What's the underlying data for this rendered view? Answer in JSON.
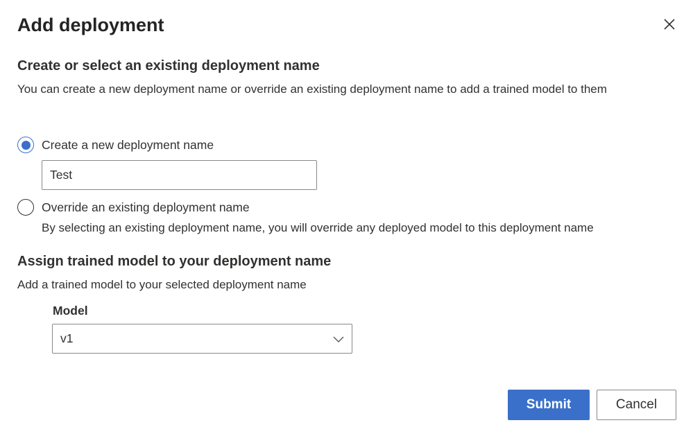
{
  "dialog": {
    "title": "Add deployment",
    "close_icon": "close-icon"
  },
  "section_name": {
    "heading": "Create or select an existing deployment name",
    "description": "You can create a new deployment name or override an existing deployment name to add a trained model to them",
    "option_create": {
      "label": "Create a new deployment name",
      "selected": true,
      "input_value": "Test"
    },
    "option_override": {
      "label": "Override an existing deployment name",
      "selected": false,
      "description": "By selecting an existing deployment name, you will override any deployed model to this deployment name"
    }
  },
  "section_model": {
    "heading": "Assign trained model to your deployment name",
    "description": "Add a trained model to your selected deployment name",
    "model_label": "Model",
    "model_value": "v1",
    "dropdown_icon": "chevron-down-icon"
  },
  "footer": {
    "submit_label": "Submit",
    "cancel_label": "Cancel"
  },
  "colors": {
    "accent": "#3a70c9",
    "text": "#323130",
    "border": "#8a8886"
  }
}
